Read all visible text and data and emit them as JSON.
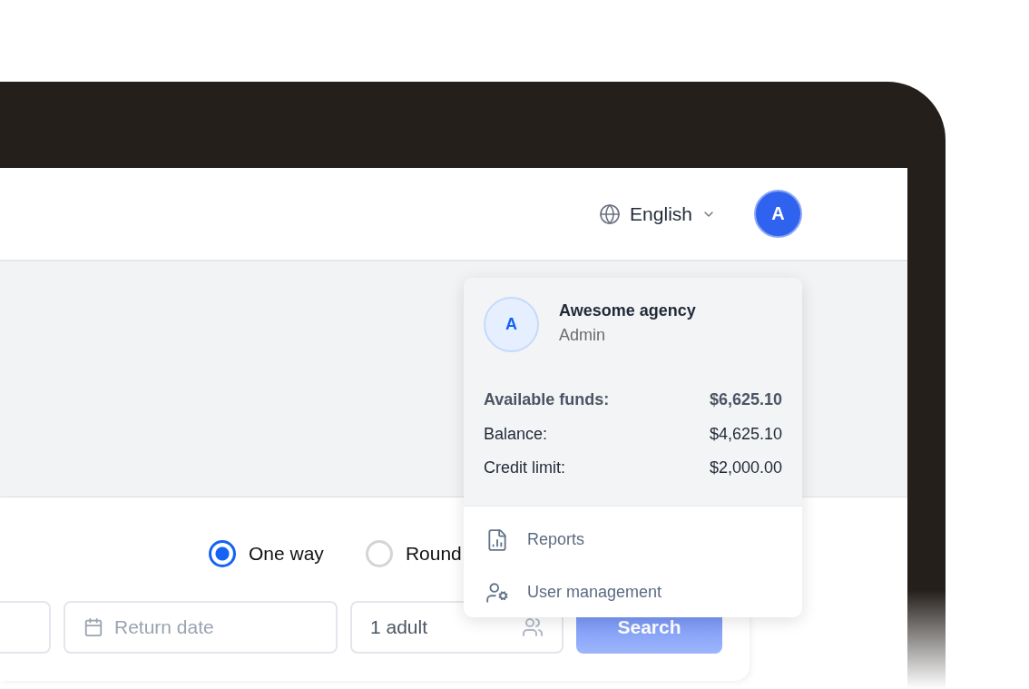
{
  "header": {
    "language": "English",
    "avatar": "A"
  },
  "trip_types": [
    {
      "label": "One way",
      "selected": true
    },
    {
      "label": "Round",
      "selected": false
    }
  ],
  "fields": [
    {
      "kind": "blank"
    },
    {
      "kind": "date",
      "placeholder": "Return date"
    },
    {
      "kind": "passengers",
      "value": "1 adult"
    }
  ],
  "search_button": "Search",
  "account_menu": {
    "avatar": "A",
    "name": "Awesome agency",
    "role": "Admin",
    "funds": [
      {
        "label": "Available funds:",
        "value": "$6,625.10",
        "bold": true
      },
      {
        "label": "Balance:",
        "value": "$4,625.10",
        "bold": false
      },
      {
        "label": "Credit limit:",
        "value": "$2,000.00",
        "bold": false
      }
    ],
    "items": [
      {
        "kind": "reports",
        "label": "Reports"
      },
      {
        "kind": "users",
        "label": "User management"
      }
    ]
  }
}
